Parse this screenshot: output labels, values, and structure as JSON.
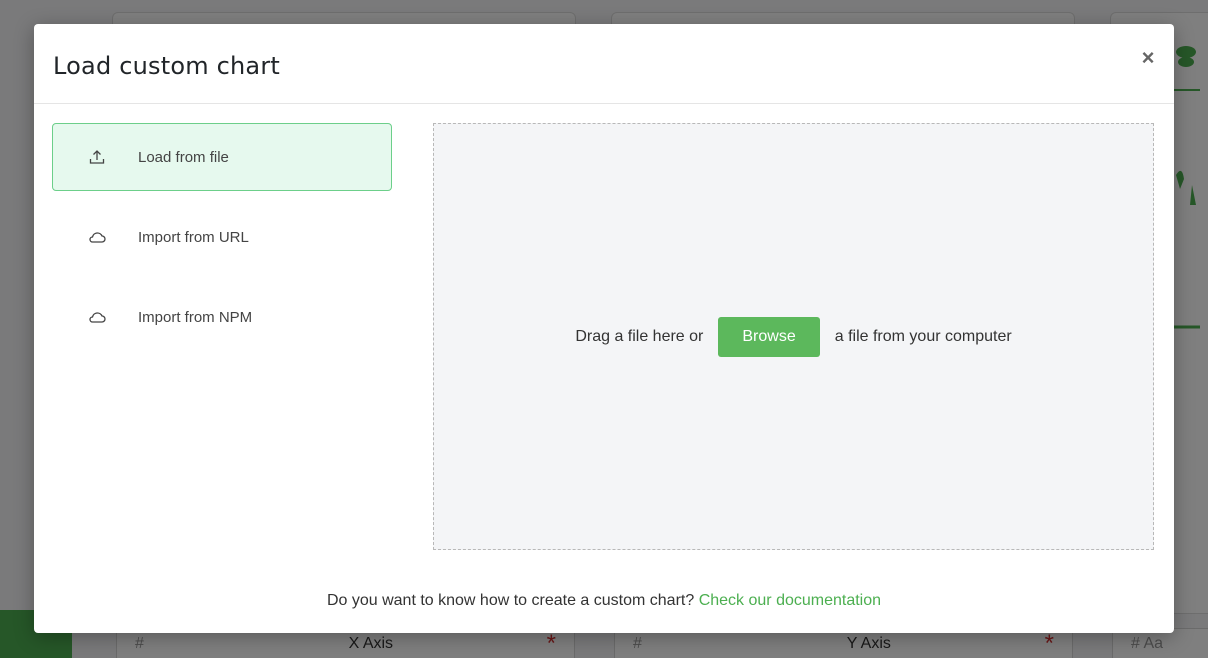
{
  "modal": {
    "title": "Load custom chart",
    "close_label": "×"
  },
  "sources": [
    {
      "label": "Load from file",
      "icon": "upload-icon",
      "active": true
    },
    {
      "label": "Import from URL",
      "icon": "cloud-icon",
      "active": false
    },
    {
      "label": "Import from NPM",
      "icon": "cloud-icon",
      "active": false
    }
  ],
  "dropzone": {
    "text_before": "Drag a file here or",
    "browse_label": "Browse",
    "text_after": "a file from your computer"
  },
  "footer": {
    "question": "Do you want to know how to create a custom chart?",
    "link_text": "Check our documentation"
  },
  "background": {
    "x_axis_label": "X Axis",
    "y_axis_label": "Y Axis",
    "x_axis_prefix": "#",
    "y_axis_prefix": "#",
    "third_prefix": "#  Aa",
    "required_mark": "*"
  },
  "colors": {
    "accent": "#5cb85c",
    "active_bg": "#e6f9ee",
    "active_border": "#6ccf8a",
    "link": "#4caf50",
    "required": "#d32f2f"
  }
}
